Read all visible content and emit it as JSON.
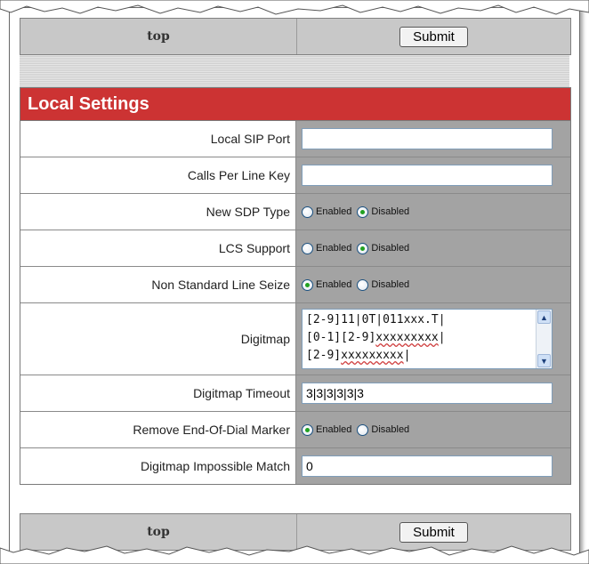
{
  "nav": {
    "top_link": "top",
    "submit_label": "Submit"
  },
  "section": {
    "title": "Local Settings"
  },
  "fields": {
    "local_sip_port": {
      "label": "Local SIP Port",
      "value": ""
    },
    "calls_per_line_key": {
      "label": "Calls Per Line Key",
      "value": ""
    },
    "new_sdp_type": {
      "label": "New SDP Type",
      "selected": "Disabled"
    },
    "lcs_support": {
      "label": "LCS Support",
      "selected": "Disabled"
    },
    "non_standard_line_seize": {
      "label": "Non Standard Line Seize",
      "selected": "Enabled"
    },
    "digitmap": {
      "label": "Digitmap",
      "lines": [
        "[2-9]11|0T|011xxx.T|",
        "[0-1][2-9]",
        "xxxxxxxxx",
        "|",
        "[2-9]",
        "xxxxxxxxx",
        "|"
      ]
    },
    "digitmap_timeout": {
      "label": "Digitmap Timeout",
      "value": "3|3|3|3|3|3"
    },
    "remove_end_of_dial_marker": {
      "label": "Remove End-Of-Dial Marker",
      "selected": "Enabled"
    },
    "digitmap_impossible_match": {
      "label": "Digitmap Impossible Match",
      "value": "0"
    }
  },
  "radio_options": {
    "enabled": "Enabled",
    "disabled": "Disabled"
  },
  "colors": {
    "header_red": "#cc3333",
    "value_cell_gray": "#a3a3a3",
    "bar_gray": "#c8c8c8"
  }
}
